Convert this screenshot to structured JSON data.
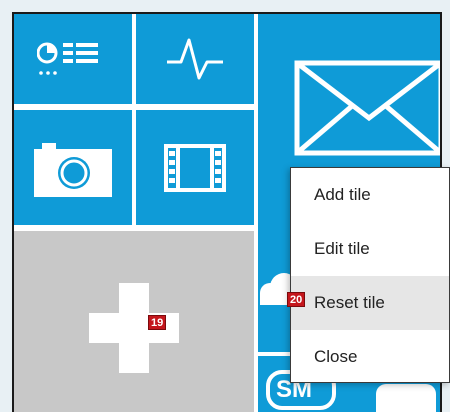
{
  "colors": {
    "tile": "#0f9bd7",
    "placeholder": "#c8c8c8",
    "badge": "#c4161c"
  },
  "tiles": [
    {
      "name": "charts-tile",
      "icon": "dashboard-list-icon"
    },
    {
      "name": "activity-tile",
      "icon": "pulse-icon"
    },
    {
      "name": "mail-tile",
      "icon": "envelope-icon"
    },
    {
      "name": "camera-tile",
      "icon": "camera-icon"
    },
    {
      "name": "video-tile",
      "icon": "film-icon"
    },
    {
      "name": "add-tile-placeholder",
      "icon": "plus-icon"
    },
    {
      "name": "weather-tile",
      "icon": "cloud-icon"
    },
    {
      "name": "sms-tile",
      "icon": "sms-icon"
    }
  ],
  "sms_label": "SM",
  "context_menu": {
    "items": [
      {
        "label": "Add tile"
      },
      {
        "label": "Edit tile"
      },
      {
        "label": "Reset tile"
      },
      {
        "label": "Close"
      }
    ]
  },
  "badges": {
    "plus": "19",
    "reset": "20"
  }
}
